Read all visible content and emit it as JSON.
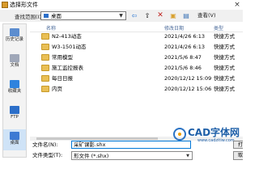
{
  "window": {
    "title": "选择形文件",
    "close_icon": "×"
  },
  "toolbar": {
    "lookin_label": "查找范围(I):",
    "lookin_value": "桌面",
    "back_icon": "⇦",
    "up_icon": "⇧",
    "delete_icon": "✕",
    "newfolder_icon": "▣",
    "views_icon": "▤",
    "tools_label": "查看(V)"
  },
  "places": [
    {
      "label": "历史记录"
    },
    {
      "label": "文档"
    },
    {
      "label": "收藏夹"
    },
    {
      "label": "FTP"
    },
    {
      "label": "桌面"
    }
  ],
  "list": {
    "headers": {
      "name": "名称",
      "date": "修改日期",
      "type": "类型"
    },
    "rows": [
      {
        "name": "N2-413动态",
        "date": "2021/4/26 6:13",
        "type": "快捷方式"
      },
      {
        "name": "W3-1501动态",
        "date": "2021/4/26 6:13",
        "type": "快捷方式"
      },
      {
        "name": "常用模型",
        "date": "2021/5/6 8:47",
        "type": "快捷方式"
      },
      {
        "name": "施工监控报表",
        "date": "2021/5/6 8:46",
        "type": "快捷方式"
      },
      {
        "name": "每日日报",
        "date": "2020/12/12 15:09",
        "type": "快捷方式"
      },
      {
        "name": "内页",
        "date": "2020/12/12 15:06",
        "type": "快捷方式"
      }
    ]
  },
  "footer": {
    "filename_label": "文件名(N):",
    "filename_value": "采矿课影.shx",
    "filetype_label": "文件类型(T):",
    "filetype_value": "形文件 (*.shx)",
    "open_label": "打",
    "cancel_label": "取"
  },
  "watermark": {
    "text": "CAD字体网",
    "url": "www.cadzitiw.com"
  }
}
